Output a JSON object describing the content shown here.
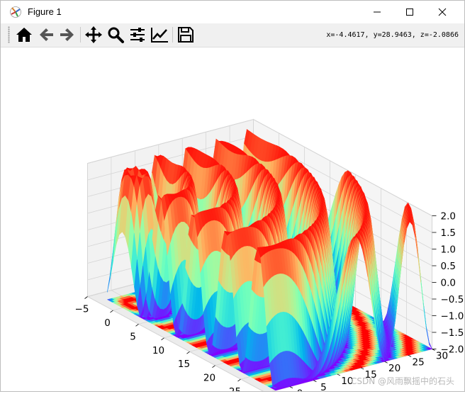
{
  "window": {
    "title": "Figure 1",
    "minimize_icon": "minimize-icon",
    "maximize_icon": "maximize-icon",
    "close_icon": "close-icon"
  },
  "toolbar": {
    "buttons": [
      {
        "name": "home-icon"
      },
      {
        "name": "back-arrow-icon"
      },
      {
        "name": "forward-arrow-icon"
      },
      {
        "name": "pan-icon"
      },
      {
        "name": "zoom-icon"
      },
      {
        "name": "subplots-icon"
      },
      {
        "name": "edit-axis-icon"
      },
      {
        "name": "save-icon"
      }
    ],
    "coordinates": "x=-4.4617, y=28.9463, z=-2.0866"
  },
  "chart_data": {
    "type": "surface3d",
    "title": "",
    "colormap": "rainbow",
    "x_ticks": [
      "−5",
      "0",
      "5",
      "10",
      "15",
      "20",
      "25",
      "30"
    ],
    "y_ticks": [
      "−5",
      "0",
      "5",
      "10",
      "15",
      "20",
      "25",
      "30"
    ],
    "z_ticks": [
      "−2.0",
      "−1.5",
      "−1.0",
      "−0.5",
      "0.0",
      "0.5",
      "1.0",
      "1.5",
      "2.0"
    ],
    "xlim": [
      -5,
      30
    ],
    "ylim": [
      -5,
      30
    ],
    "zlim": [
      -2,
      2
    ],
    "surface_range": {
      "x": [
        -3,
        30
      ],
      "y": [
        -3,
        30
      ]
    },
    "contour_offset_z": -2,
    "grid": true
  },
  "watermark": "CSDN @风雨飘摇中的石头",
  "colors": {
    "accent": "#1f77b4",
    "toolbar_bg": "#f0f0f0",
    "pane_bg": "#f2f2f2"
  }
}
